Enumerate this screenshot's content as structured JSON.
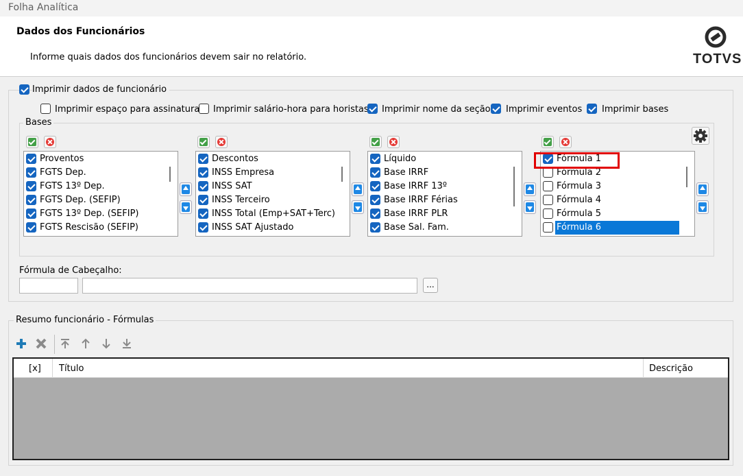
{
  "window": {
    "title": "Folha Analítica"
  },
  "header": {
    "title": "Dados dos Funcionários",
    "subtitle": "Informe quais dados dos funcionários devem sair no relatório.",
    "logo_text": "TOTVS"
  },
  "print_group": {
    "main_checkbox": {
      "label": "Imprimir dados de funcionário",
      "checked": true
    },
    "options": [
      {
        "label": "Imprimir espaço para assinatura",
        "checked": false
      },
      {
        "label": "Imprimir salário-hora para horistas",
        "checked": false
      },
      {
        "label": "Imprimir nome da seção",
        "checked": true
      },
      {
        "label": "Imprimir eventos",
        "checked": true
      },
      {
        "label": "Imprimir bases",
        "checked": true
      }
    ]
  },
  "bases": {
    "legend": "Bases",
    "lists": [
      {
        "items": [
          {
            "label": "Proventos",
            "checked": true
          },
          {
            "label": "FGTS Dep.",
            "checked": true
          },
          {
            "label": "FGTS 13º Dep.",
            "checked": true
          },
          {
            "label": "FGTS Dep. (SEFIP)",
            "checked": true
          },
          {
            "label": "FGTS 13º Dep. (SEFIP)",
            "checked": true
          },
          {
            "label": "FGTS Rescisão (SEFIP)",
            "checked": true
          }
        ]
      },
      {
        "items": [
          {
            "label": "Descontos",
            "checked": true
          },
          {
            "label": "INSS Empresa",
            "checked": true
          },
          {
            "label": "INSS SAT",
            "checked": true
          },
          {
            "label": "INSS Terceiro",
            "checked": true
          },
          {
            "label": "INSS Total (Emp+SAT+Terc)",
            "checked": true
          },
          {
            "label": "INSS SAT Ajustado",
            "checked": true
          }
        ]
      },
      {
        "items": [
          {
            "label": "Líquido",
            "checked": true
          },
          {
            "label": "Base IRRF",
            "checked": true
          },
          {
            "label": "Base IRRF 13º",
            "checked": true
          },
          {
            "label": "Base IRRF Férias",
            "checked": true
          },
          {
            "label": "Base IRRF PLR",
            "checked": true
          },
          {
            "label": "Base Sal. Fam.",
            "checked": true
          }
        ]
      },
      {
        "items": [
          {
            "label": "Fórmula 1",
            "checked": true
          },
          {
            "label": "Fórmula 2",
            "checked": false
          },
          {
            "label": "Fórmula 3",
            "checked": false
          },
          {
            "label": "Fórmula 4",
            "checked": false
          },
          {
            "label": "Fórmula 5",
            "checked": false
          },
          {
            "label": "Fórmula 6",
            "checked": false,
            "selected": true
          }
        ]
      }
    ]
  },
  "header_formula": {
    "label": "Fórmula de Cabeçalho:",
    "code_value": "",
    "desc_value": "",
    "browse_label": "..."
  },
  "resumo": {
    "legend": "Resumo funcionário - Fórmulas",
    "columns": [
      "[x]",
      "Título",
      "Descrição"
    ]
  },
  "colors": {
    "accent": "#1565c0",
    "selection": "#0a78d7",
    "highlight": "#e10000"
  }
}
